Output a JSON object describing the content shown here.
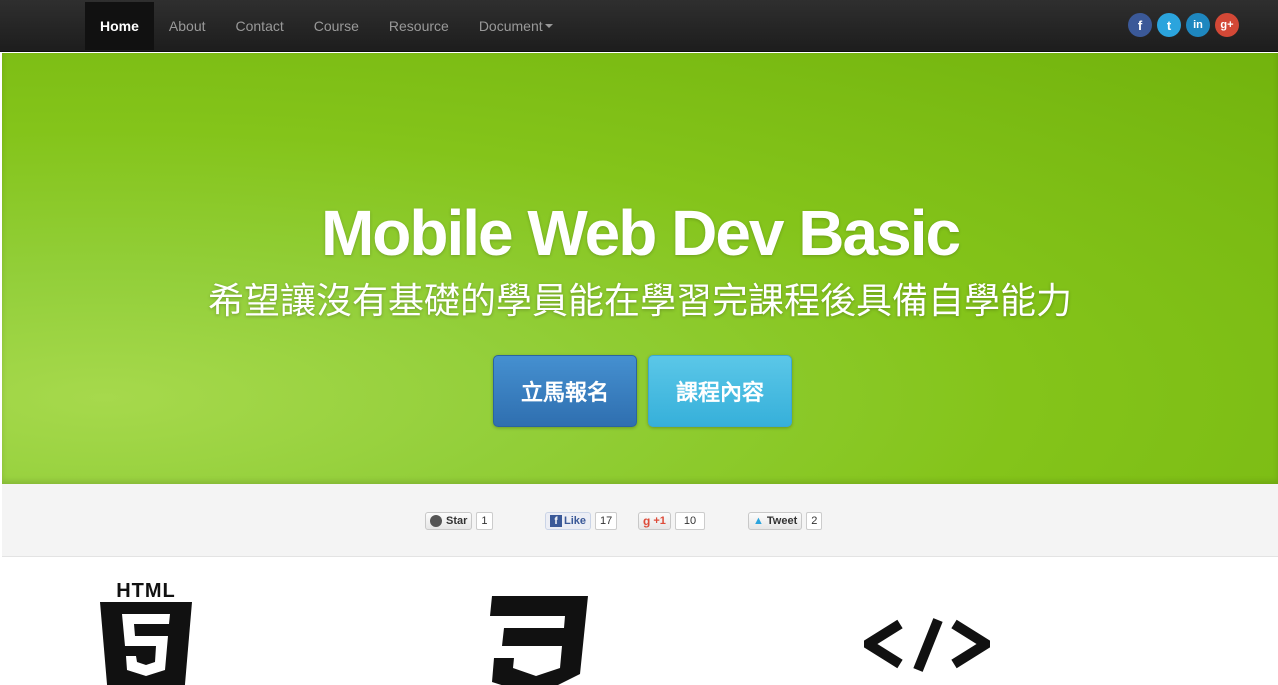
{
  "nav": {
    "items": [
      {
        "label": "Home",
        "active": true
      },
      {
        "label": "About",
        "active": false
      },
      {
        "label": "Contact",
        "active": false
      },
      {
        "label": "Course",
        "active": false
      },
      {
        "label": "Resource",
        "active": false
      },
      {
        "label": "Document",
        "active": false,
        "dropdown": true
      }
    ],
    "social": [
      {
        "icon": "facebook-icon",
        "glyph": "f",
        "color": "#3b5998"
      },
      {
        "icon": "twitter-icon",
        "glyph": "t",
        "color": "#2ba4dd"
      },
      {
        "icon": "linkedin-icon",
        "glyph": "in",
        "color": "#1e87bf"
      },
      {
        "icon": "google-plus-icon",
        "glyph": "g+",
        "color": "#d34836"
      }
    ]
  },
  "hero": {
    "title": "Mobile Web Dev Basic",
    "subtitle": "希望讓沒有基礎的學員能在學習完課程後具備自學能力",
    "primary_button": "立馬報名",
    "secondary_button": "課程內容",
    "background_color": "#84c41a"
  },
  "social_bar": {
    "github_star": {
      "label": "Star",
      "count": "1"
    },
    "facebook_like": {
      "label": "Like",
      "count": "17"
    },
    "google_plus": {
      "label": "+1",
      "count": "10"
    },
    "tweet": {
      "label": "Tweet",
      "count": "2"
    }
  },
  "tech_icons": {
    "html5_label": "HTML",
    "icons": [
      "html5-icon",
      "css3-icon",
      "code-icon"
    ]
  }
}
